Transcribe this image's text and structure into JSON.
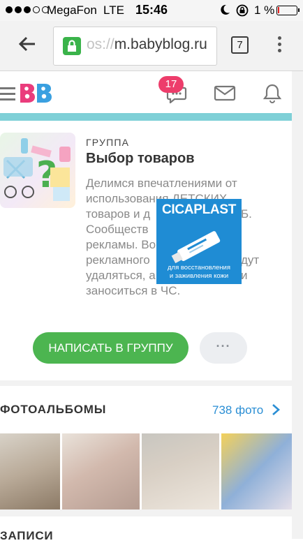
{
  "status": {
    "carrier": "MegaFon",
    "network": "LTE",
    "time": "15:46",
    "battery": "1 %",
    "signal_bars": 3
  },
  "browser": {
    "url_faded": "os://",
    "url_domain": "m.babyblog.ru",
    "tab_count": "7"
  },
  "site": {
    "logo": "BB",
    "messages_badge": "17",
    "teal_color": "#7fd0d7"
  },
  "group": {
    "label": "ГРУППА",
    "title": "Выбор товаров",
    "description": "Делимся впечатлениями от использования ДЕТСКИХ товаров и д... Сообществ... рекламы. Во... рекламного... удалять, а... заноситься в ЧС.",
    "description_lines": [
      "Делимся впечатлениями от",
      "использования ДЕТСКИХ",
      "товаров и д",
      "Сообществ",
      "рекламы. Во",
      "рекламного",
      "удаляться, а",
      "заноситься в ЧС."
    ],
    "description_right": [
      "",
      "",
      "Б.",
      "",
      "",
      "дут",
      "и",
      ""
    ],
    "write_button": "НАПИСАТЬ В ГРУППУ",
    "more_button": "···"
  },
  "ad": {
    "brand": "CICAPLAST",
    "caption_line1": "для восстановления",
    "caption_line2": "и заживления кожи",
    "color": "#1f8cd4"
  },
  "albums": {
    "title": "ФОТОАЛЬБОМЫ",
    "count": "738 фото"
  },
  "posts": {
    "title": "ЗАПИСИ"
  }
}
